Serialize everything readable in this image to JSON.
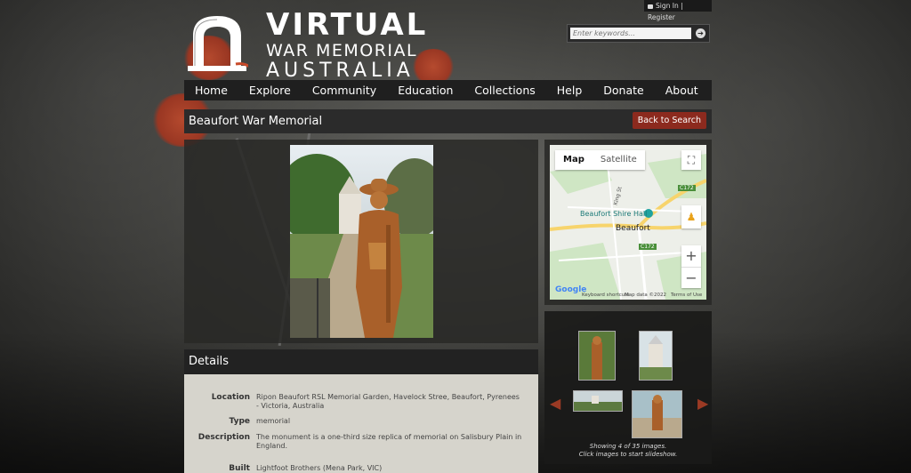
{
  "header": {
    "logo": {
      "line1": "VIRTUAL",
      "line2": "WAR MEMORIAL",
      "line3": "AUSTRALIA"
    },
    "signin": "Sign In | Register",
    "search_placeholder": "Enter keywords..."
  },
  "nav": {
    "items": [
      "Home",
      "Explore",
      "Community",
      "Education",
      "Collections",
      "Help",
      "Donate",
      "About"
    ]
  },
  "page": {
    "title": "Beaufort War Memorial",
    "back_label": "Back to Search"
  },
  "map": {
    "tab_map": "Map",
    "tab_satellite": "Satellite",
    "poi": "Beaufort Shire Hall",
    "town": "Beaufort",
    "road1": "C172",
    "road2": "C172",
    "street": "King St",
    "footer_shortcuts": "Keyboard shortcuts",
    "footer_data": "Map data ©2022",
    "footer_terms": "Terms of Use",
    "zoom_in": "+",
    "zoom_out": "−"
  },
  "gallery": {
    "caption1": "Showing 4 of 35 images.",
    "caption2": "Click images to start slideshow."
  },
  "details": {
    "heading": "Details",
    "rows": [
      {
        "key": "Location",
        "value": "Ripon Beaufort RSL Memorial Garden, Havelock Stree, Beaufort, Pyrenees - Victoria, Australia"
      },
      {
        "key": "Type",
        "value": "memorial"
      },
      {
        "key": "Description",
        "value": "The monument is a one-third size replica of memorial on Salisbury Plain in England."
      },
      {
        "key": "Built",
        "value": "Lightfoot Brothers (Mena Park, VIC)"
      }
    ]
  },
  "colors": {
    "accent": "#8c2a1e",
    "nav_bg": "#1f1f1f",
    "details_bg": "#d6d4cc"
  }
}
